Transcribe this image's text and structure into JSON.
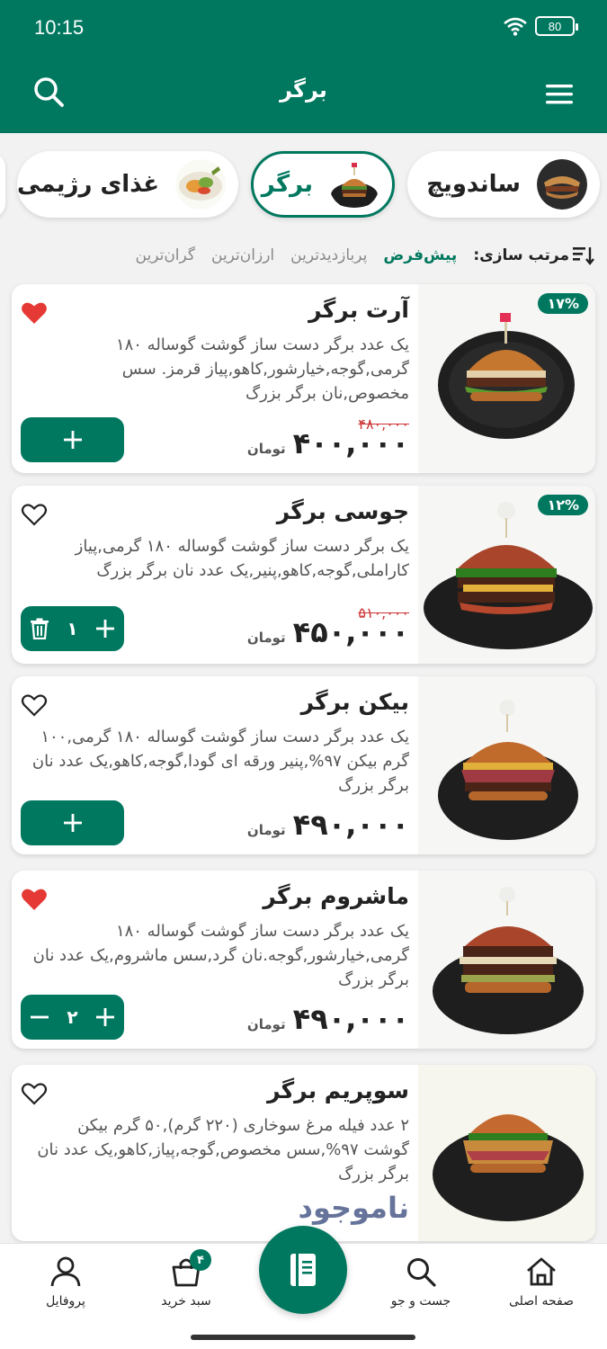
{
  "status": {
    "time": "10:15",
    "battery": "80"
  },
  "header": {
    "title": "برگر"
  },
  "categories": [
    {
      "label": "ساندویچ",
      "icon": "sandwich-image",
      "active": false
    },
    {
      "label": "برگر",
      "icon": "burger-image",
      "active": true
    },
    {
      "label": "غذای رژیمی",
      "icon": "diet-food-image",
      "active": false
    }
  ],
  "sort": {
    "label": "مرتب سازی:",
    "options": [
      "پیش‌فرض",
      "پربازدیدترین",
      "ارزان‌ترین",
      "گران‌ترین"
    ],
    "selected": "پیش‌فرض"
  },
  "products": [
    {
      "title": "آرت برگر",
      "description": "یک عدد برگر دست ساز گوشت گوساله ۱۸۰ گرمی,گوجه,خیارشور,کاهو,پیاز قرمز. سس مخصوص,نان برگر بزرگ",
      "old_price": "۴۸۰,۰۰۰",
      "price": "۴۰۰,۰۰۰",
      "currency": "تومان",
      "discount": "۱۷%",
      "favorite": true,
      "quantity": null,
      "available": true
    },
    {
      "title": "جوسی برگر",
      "description": "یک برگر دست ساز گوشت گوساله ۱۸۰ گرمی,پیاز کاراملی,گوجه,کاهو,پنیر,یک عدد نان برگر بزرگ",
      "old_price": "۵۱۰,۰۰۰",
      "price": "۴۵۰,۰۰۰",
      "currency": "تومان",
      "discount": "۱۲%",
      "favorite": false,
      "quantity": "۱",
      "available": true
    },
    {
      "title": "بیکن برگر",
      "description": "یک عدد برگر دست ساز گوشت گوساله ۱۸۰ گرمی,۱۰۰ گرم بیکن ۹۷%,پنیر ورقه ای گودا,گوجه,کاهو,یک عدد نان برگر بزرگ",
      "old_price": "",
      "price": "۴۹۰,۰۰۰",
      "currency": "تومان",
      "discount": "",
      "favorite": false,
      "quantity": null,
      "available": true
    },
    {
      "title": "ماشروم برگر",
      "description": "یک عدد برگر دست ساز گوشت گوساله ۱۸۰ گرمی,خیارشور,گوجه.نان گرد,سس ماشروم,یک عدد نان برگر بزرگ",
      "old_price": "",
      "price": "۴۹۰,۰۰۰",
      "currency": "تومان",
      "discount": "",
      "favorite": true,
      "quantity": "۲",
      "available": true
    },
    {
      "title": "سوپریم برگر",
      "description": "۲ عدد فیله مرغ سوخاری (۲۲۰ گرم),۵۰ گرم بیکن گوشت ۹۷%,سس مخصوص,گوجه,پیاز,کاهو,یک عدد نان برگر بزرگ",
      "unavailable_label": "ناموجود",
      "favorite": false,
      "available": false
    }
  ],
  "bottom_nav": {
    "items": [
      {
        "label": "صفحه اصلی",
        "icon": "home-icon"
      },
      {
        "label": "جست و جو",
        "icon": "search-icon"
      },
      {
        "label": "",
        "icon": "menu-book-icon"
      },
      {
        "label": "سبد خرید",
        "icon": "cart-icon",
        "badge": "۴"
      },
      {
        "label": "پروفایل",
        "icon": "profile-icon"
      }
    ]
  },
  "colors": {
    "primary": "#00785f",
    "heart": "#e53935",
    "old_price": "#cc3333",
    "unavailable": "#66739a"
  }
}
